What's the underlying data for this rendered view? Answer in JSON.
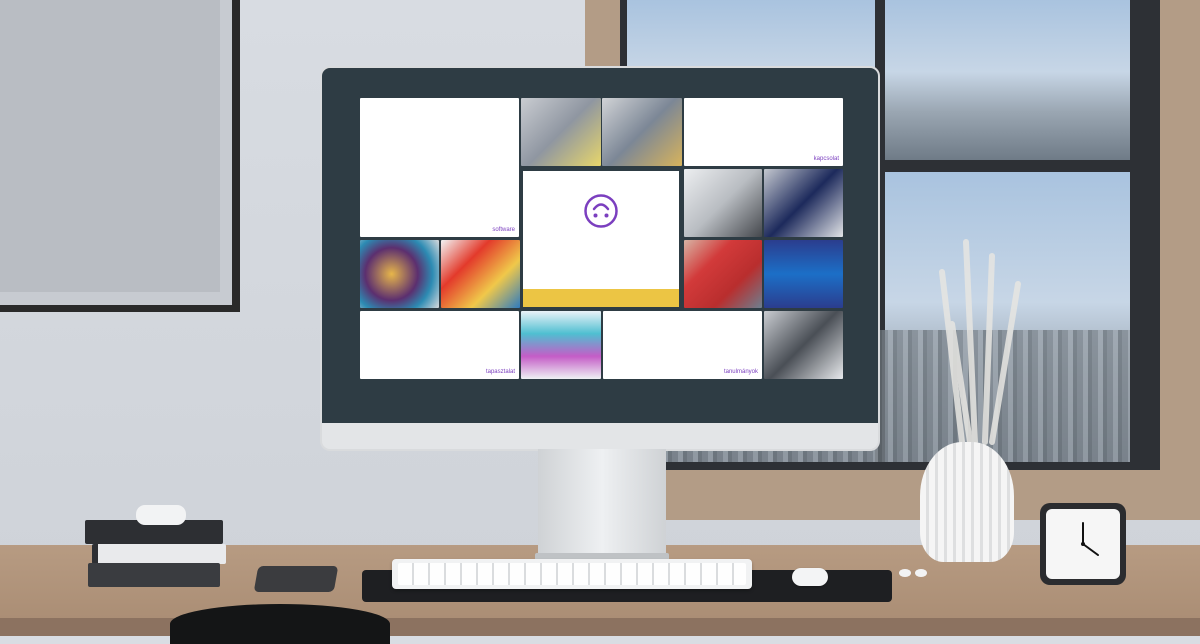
{
  "scene": {
    "description_objects": [
      "monitor",
      "keyboard",
      "mouse",
      "desk",
      "window",
      "vase",
      "clock",
      "books",
      "phone"
    ]
  },
  "screen": {
    "tiles": [
      {
        "id": "software",
        "label": "software"
      },
      {
        "id": "kapcsolat",
        "label": "kapcsolat"
      },
      {
        "id": "tapasztalat",
        "label": "tapasztalat"
      },
      {
        "id": "tanulmanyok",
        "label": "tanulmányok"
      }
    ],
    "center_icon": "smiley-icon",
    "center_bar_color": "#ECC544",
    "accent_color": "#7B3FBF"
  },
  "clock": {
    "time": "4:03"
  }
}
